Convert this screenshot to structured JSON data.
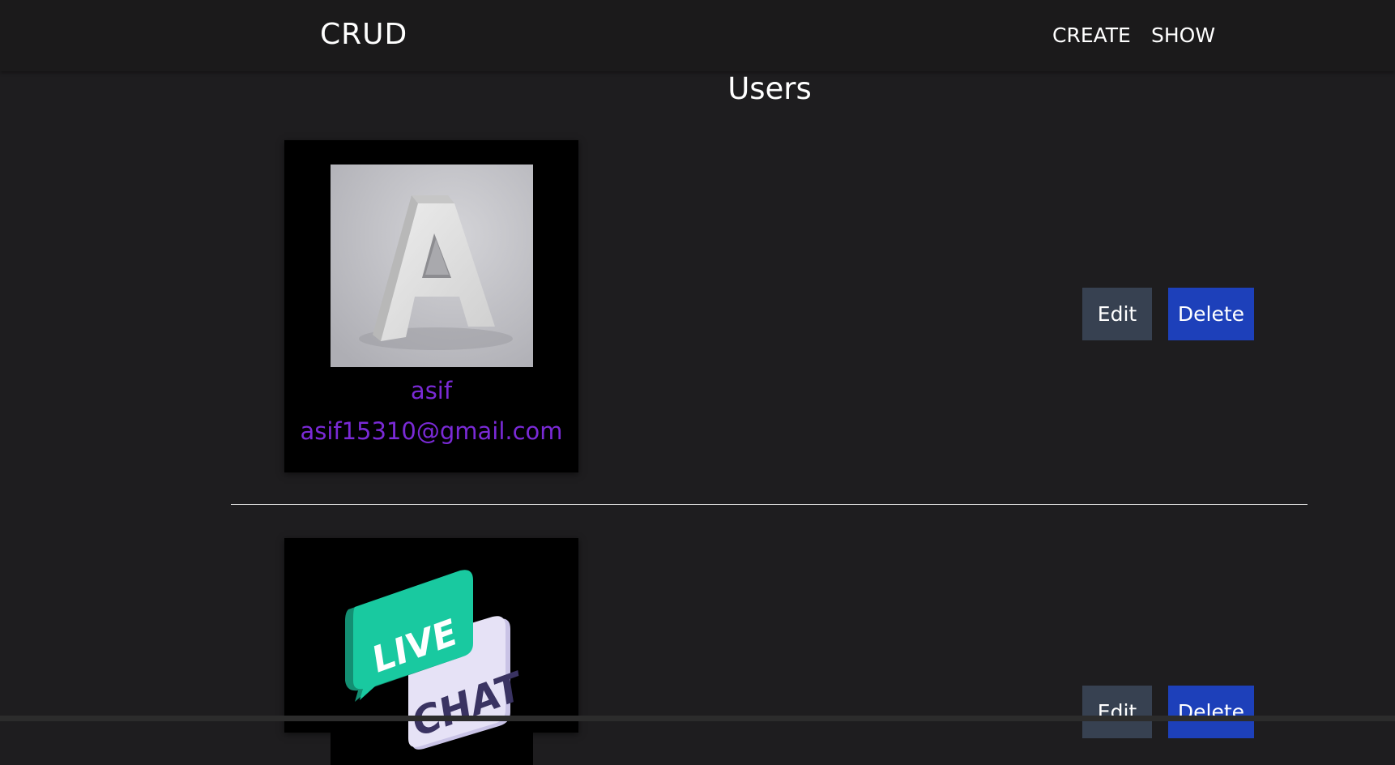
{
  "nav": {
    "brand": "CRUD",
    "links": [
      "CREATE",
      "SHOW"
    ]
  },
  "page": {
    "title": "Users"
  },
  "users": [
    {
      "name": "asif",
      "email": "asif15310@gmail.com",
      "avatar_icon": "letter-a-photo",
      "edit_label": "Edit",
      "delete_label": "Delete"
    },
    {
      "name": "",
      "email": "",
      "avatar_icon": "live-chat-icon",
      "avatar_text": [
        "LIVE",
        "CHAT"
      ],
      "edit_label": "Edit",
      "delete_label": "Delete"
    }
  ],
  "colors": {
    "background": "#1e1d1f",
    "navbar": "#1b1a1b",
    "card": "#000000",
    "user_text": "#7a2ad6",
    "edit_button": "#374151",
    "delete_button": "#1d40ba",
    "chat_green": "#19c9a0",
    "chat_lilac": "#e4e0f4"
  }
}
